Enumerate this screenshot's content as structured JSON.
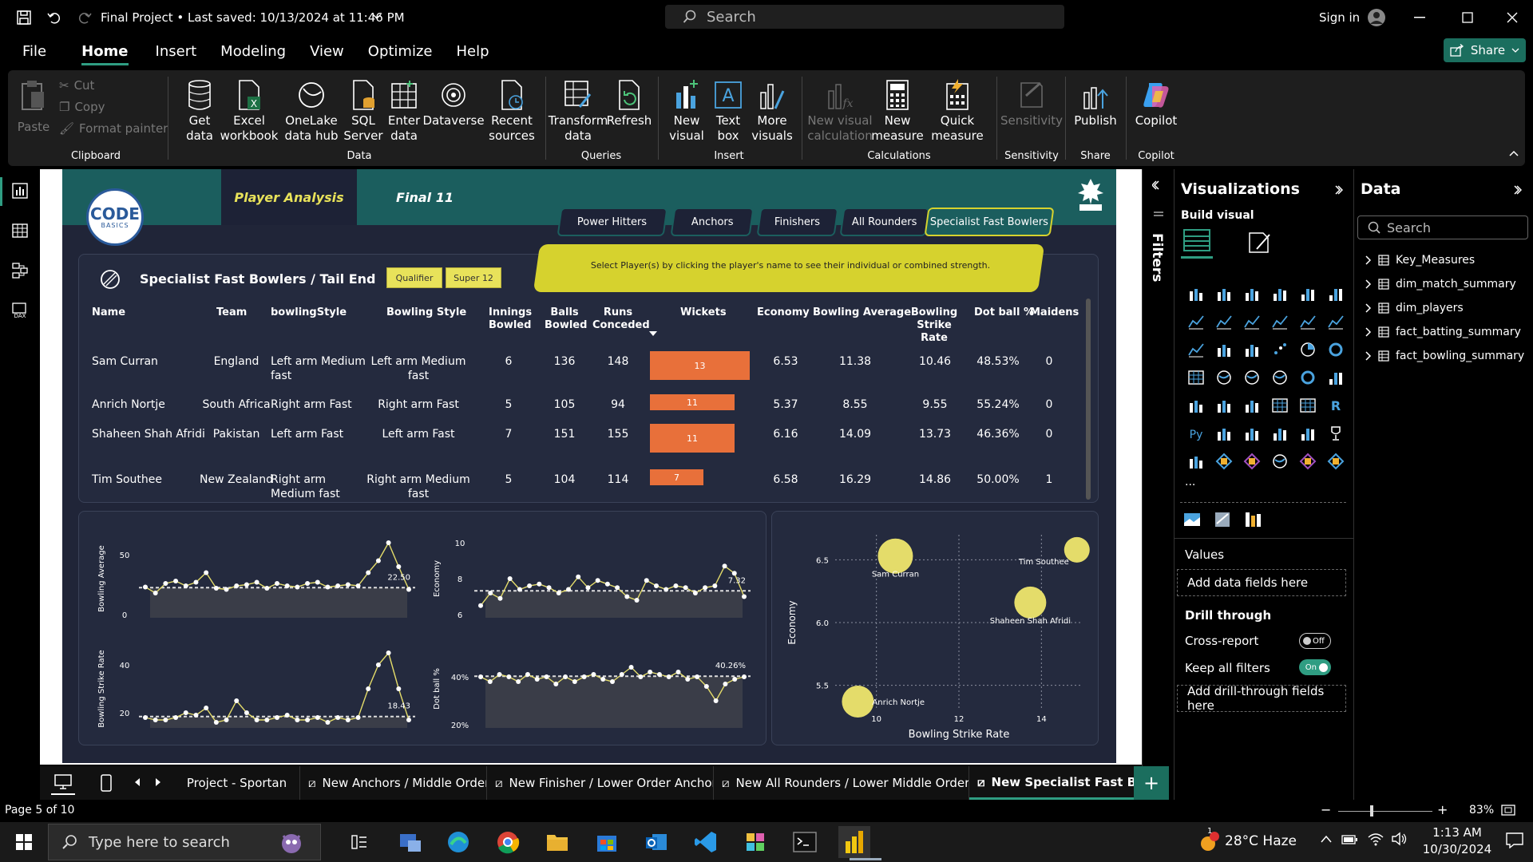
{
  "window": {
    "title": "Final Project • Last saved: 10/13/2024 at 11:46 PM",
    "search_placeholder": "Search",
    "sign_in": "Sign in"
  },
  "menu": {
    "items": [
      "File",
      "Home",
      "Insert",
      "Modeling",
      "View",
      "Optimize",
      "Help"
    ],
    "active": "Home",
    "share": "Share"
  },
  "ribbon": {
    "clipboard": {
      "paste": "Paste",
      "cut": "Cut",
      "copy": "Copy",
      "format_painter": "Format painter",
      "group": "Clipboard"
    },
    "data": {
      "get_data": "Get data",
      "excel": "Excel workbook",
      "onelake": "OneLake data hub",
      "sql": "SQL Server",
      "enter_data": "Enter data",
      "dataverse": "Dataverse",
      "recent": "Recent sources",
      "group": "Data"
    },
    "queries": {
      "transform": "Transform data",
      "refresh": "Refresh",
      "group": "Queries"
    },
    "insert": {
      "new_visual": "New visual",
      "text_box": "Text box",
      "more_visuals": "More visuals",
      "group": "Insert"
    },
    "calculations": {
      "new_visual_calc": "New visual calculation",
      "new_measure": "New measure",
      "quick_measure": "Quick measure",
      "group": "Calculations"
    },
    "sensitivity": {
      "label": "Sensitivity",
      "group": "Sensitivity"
    },
    "share": {
      "publish": "Publish",
      "group": "Share"
    },
    "copilot": {
      "label": "Copilot",
      "group": "Copilot"
    }
  },
  "report": {
    "logo_text": "ODE",
    "logo_sub": "BASICS",
    "nav_tabs": [
      "Player Analysis",
      "Final 11"
    ],
    "segments": [
      "Power Hitters",
      "Anchors",
      "Finishers",
      "All Rounders",
      "Specialist Fast Bowlers"
    ],
    "active_segment": "Specialist Fast Bowlers",
    "banner": "Select Player(s) by clicking the player's name to see their individual or combined strength.",
    "table_title": "Specialist Fast Bowlers / Tail End",
    "stage_pills": [
      "Qualifier",
      "Super 12"
    ],
    "columns": [
      "Name",
      "Team",
      "bowlingStyle",
      "Bowling Style",
      "Innings Bowled",
      "Balls Bowled",
      "Runs Conceded",
      "Wickets",
      "Economy",
      "Bowling Average",
      "Bowling Strike Rate",
      "Dot ball %",
      "Maidens"
    ],
    "rows": [
      {
        "name": "Sam Curran",
        "team": "England",
        "bowlingStyle": "Left arm Medium fast",
        "style": "Left arm Medium fast",
        "innings": "6",
        "balls": "136",
        "runs": "148",
        "wickets": 13,
        "wickets_label": "13",
        "economy": "6.53",
        "average": "11.38",
        "strike_rate": "10.46",
        "dot": "48.53%",
        "maidens": "0"
      },
      {
        "name": "Anrich Nortje",
        "team": "South Africa",
        "bowlingStyle": "Right arm Fast",
        "style": "Right arm Fast",
        "innings": "5",
        "balls": "105",
        "runs": "94",
        "wickets": 11,
        "wickets_label": "11",
        "economy": "5.37",
        "average": "8.55",
        "strike_rate": "9.55",
        "dot": "55.24%",
        "maidens": "0"
      },
      {
        "name": "Shaheen Shah Afridi",
        "team": "Pakistan",
        "bowlingStyle": "Left arm Fast",
        "style": "Left arm Fast",
        "innings": "7",
        "balls": "151",
        "runs": "155",
        "wickets": 11,
        "wickets_label": "11",
        "economy": "6.16",
        "average": "14.09",
        "strike_rate": "13.73",
        "dot": "46.36%",
        "maidens": "0"
      },
      {
        "name": "Tim Southee",
        "team": "New Zealand",
        "bowlingStyle": "Right arm Medium fast",
        "style": "Right arm Medium fast",
        "innings": "5",
        "balls": "104",
        "runs": "114",
        "wickets": 7,
        "wickets_label": "7",
        "economy": "6.58",
        "average": "16.29",
        "strike_rate": "14.86",
        "dot": "50.00%",
        "maidens": "1"
      }
    ]
  },
  "chart_data": [
    {
      "type": "line",
      "ylabel": "Bowling Average",
      "ylim": [
        0,
        60
      ],
      "yticks": [
        "0",
        "50"
      ],
      "values": [
        23,
        18,
        26,
        28,
        24,
        27,
        35,
        22,
        21,
        24,
        25,
        27,
        22,
        26,
        24,
        23,
        26,
        27,
        23,
        24,
        25,
        24,
        35,
        45,
        60,
        40,
        21
      ],
      "reference": 22.5,
      "ref_label": "22.50"
    },
    {
      "type": "line",
      "ylabel": "Economy",
      "ylim": [
        6,
        10
      ],
      "yticks": [
        "6",
        "8",
        "10"
      ],
      "values": [
        6.5,
        7.2,
        6.9,
        8.0,
        7.4,
        7.6,
        7.7,
        7.5,
        7.2,
        7.4,
        8.1,
        7.5,
        7.9,
        7.7,
        7.5,
        7.0,
        6.8,
        7.9,
        7.6,
        7.4,
        7.6,
        7.5,
        7.2,
        7.5,
        7.6,
        8.7,
        8.3,
        7.0
      ],
      "reference": 7.32,
      "ref_label": "7.32"
    },
    {
      "type": "line",
      "ylabel": "Bowling Strike Rate",
      "ylim": [
        15,
        45
      ],
      "yticks": [
        "20",
        "40"
      ],
      "values": [
        18,
        17,
        17,
        18,
        20,
        19,
        22,
        16,
        17,
        25,
        20,
        17,
        17,
        18,
        19,
        17,
        17,
        18,
        16,
        18,
        17,
        18,
        30,
        40,
        45,
        30,
        17
      ],
      "reference": 18.43,
      "ref_label": "18.43"
    },
    {
      "type": "line",
      "ylabel": "Dot ball %",
      "ylim": [
        20,
        50
      ],
      "yticks": [
        "20%",
        "40%"
      ],
      "values": [
        40,
        38,
        41,
        40,
        38,
        41,
        39,
        40,
        37,
        40,
        38,
        40,
        41,
        39,
        38,
        41,
        44,
        40,
        42,
        41,
        40,
        42,
        39,
        40,
        36,
        30,
        37,
        39,
        40
      ],
      "reference": 40.26,
      "ref_label": "40.26%"
    },
    {
      "type": "scatter",
      "xlabel": "Bowling Strike Rate",
      "ylabel": "Economy",
      "xlim": [
        9,
        15
      ],
      "ylim": [
        5.3,
        6.7
      ],
      "xticks": [
        "10",
        "12",
        "14"
      ],
      "yticks": [
        "5.5",
        "6.0",
        "6.5"
      ],
      "points": [
        {
          "label": "Sam Curran",
          "x": 10.46,
          "y": 6.53,
          "size": 13
        },
        {
          "label": "Anrich Nortje",
          "x": 9.55,
          "y": 5.37,
          "size": 11
        },
        {
          "label": "Shaheen Shah Afridi",
          "x": 13.73,
          "y": 6.16,
          "size": 11
        },
        {
          "label": "Tim Southee",
          "x": 14.86,
          "y": 6.58,
          "size": 7
        }
      ]
    }
  ],
  "filters": {
    "label": "Filters"
  },
  "visualizations": {
    "title": "Visualizations",
    "build": "Build visual",
    "more": "...",
    "values": "Values",
    "add_fields": "Add data fields here",
    "drill": "Drill through",
    "cross_report": "Cross-report",
    "cross_state": "Off",
    "keep_filters": "Keep all filters",
    "keep_state": "On",
    "drill_fields": "Add drill-through fields here",
    "r_icon": "R",
    "py_icon": "Py"
  },
  "data_pane": {
    "title": "Data",
    "search": "Search",
    "tables": [
      "Key_Measures",
      "dim_match_summary",
      "dim_players",
      "fact_batting_summary",
      "fact_bowling_summary"
    ]
  },
  "pages": {
    "tabs": [
      "Project - Sportan",
      "New Anchors / Middle Order",
      "New Finisher / Lower Order Anchor",
      "New All Rounders / Lower Middle Order",
      "New Specialist Fast Bowle"
    ],
    "active": "New Specialist Fast Bowle",
    "status": "Page 5 of 10",
    "zoom": "83%"
  },
  "taskbar": {
    "search": "Type here to search",
    "weather": "28°C  Haze",
    "time": "1:13 AM",
    "date": "10/30/2024",
    "badge": "1"
  },
  "colors": {
    "accent": "#2f9d82",
    "header_teal": "#1b5e5e",
    "bar": "#e8703a",
    "bubble": "#e4dc6a",
    "report_bg": "#202538"
  }
}
